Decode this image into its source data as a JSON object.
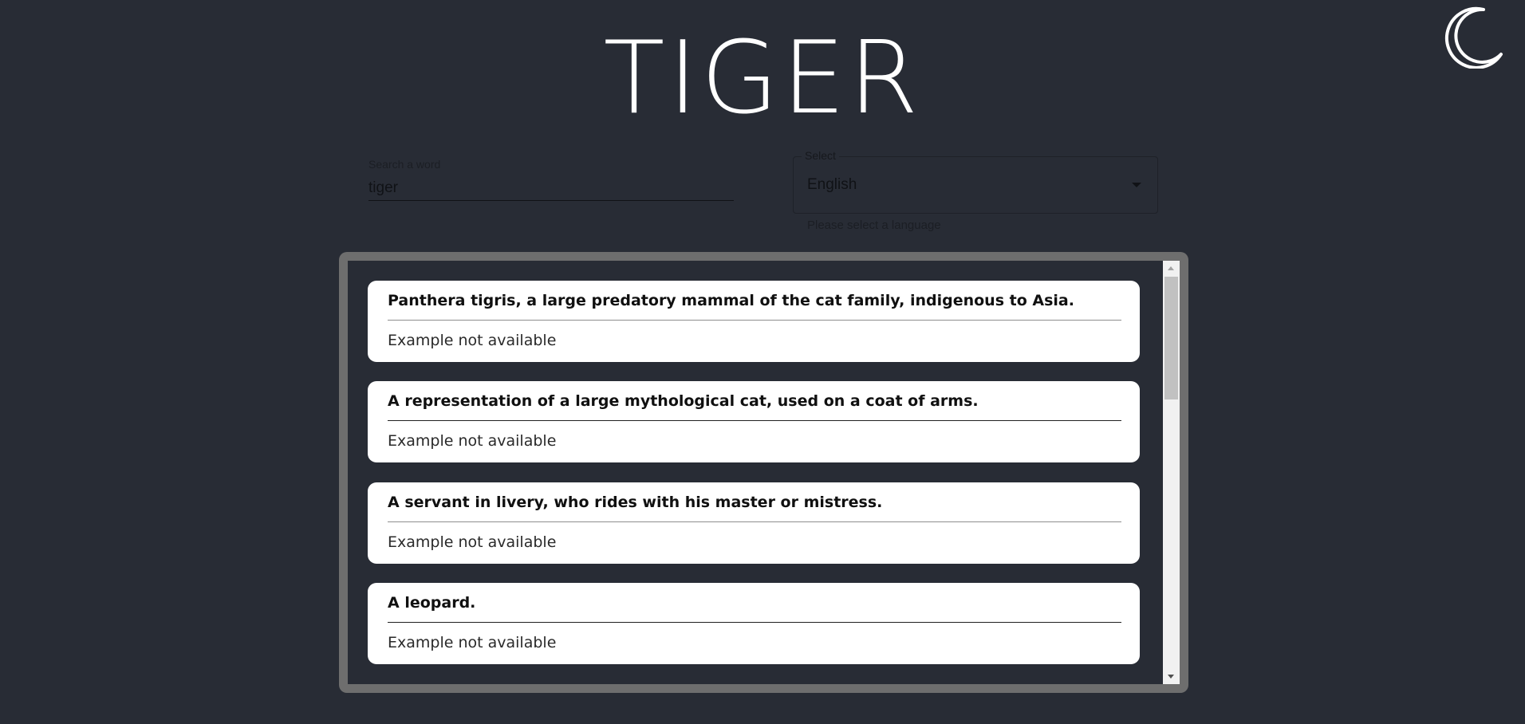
{
  "page": {
    "title": "TIGER"
  },
  "theme_toggle": {
    "icon": "moon-icon",
    "color": "#ffffff"
  },
  "search": {
    "label": "Search a word",
    "value": "tiger"
  },
  "language_select": {
    "label": "Select",
    "value": "English",
    "helper": "Please select a language"
  },
  "results": [
    {
      "definition": "Panthera tigris, a large predatory mammal of the cat family, indigenous to Asia.",
      "example": "Example not available"
    },
    {
      "definition": "A representation of a large mythological cat, used on a coat of arms.",
      "example": "Example not available"
    },
    {
      "definition": "A servant in livery, who rides with his master or mistress.",
      "example": "Example not available"
    },
    {
      "definition": "A leopard.",
      "example": "Example not available"
    }
  ],
  "colors": {
    "background": "#282c35",
    "panel_border": "#6e6e6e",
    "card": "#ffffff"
  }
}
